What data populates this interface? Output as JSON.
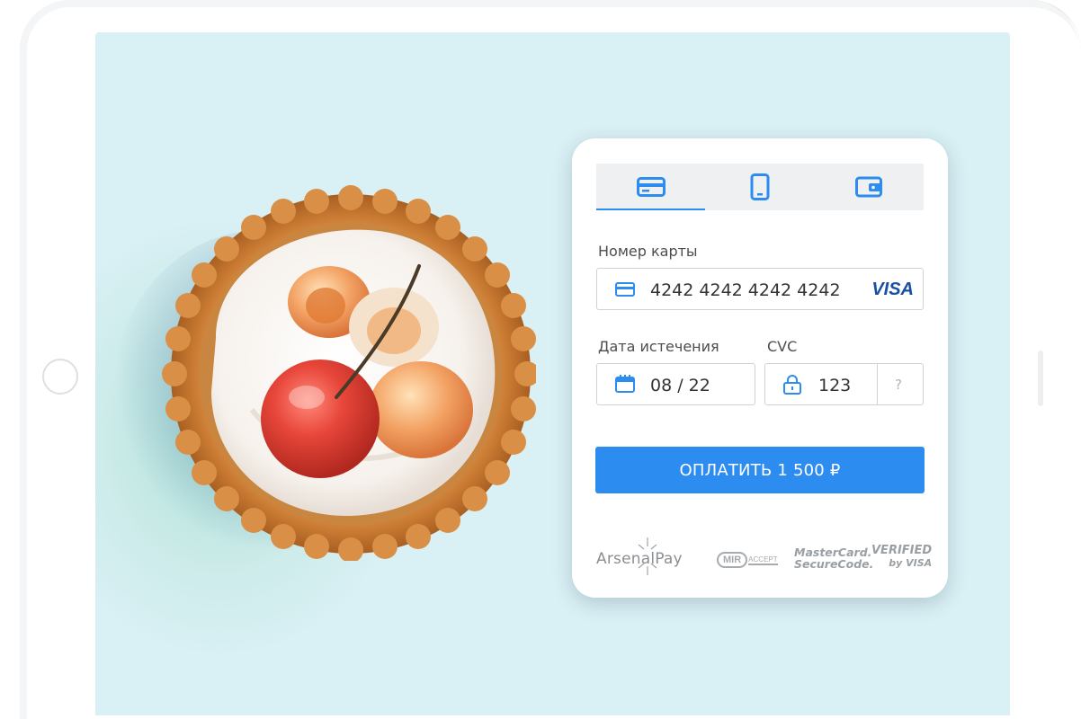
{
  "payment_tabs": [
    {
      "name": "card",
      "icon": "credit-card-icon",
      "active": true
    },
    {
      "name": "phone",
      "icon": "mobile-phone-icon",
      "active": false
    },
    {
      "name": "wallet",
      "icon": "wallet-icon",
      "active": false
    }
  ],
  "card_number": {
    "label": "Номер карты",
    "value": "4242 4242 4242 4242",
    "brand": "VISA"
  },
  "expiry": {
    "label": "Дата истечения",
    "value": "08 / 22"
  },
  "cvc": {
    "label": "CVC",
    "value": "123",
    "help": "?"
  },
  "pay_button": {
    "label": "ОПЛАТИТЬ 1 500 ₽"
  },
  "logos": {
    "arsenalpay": "ArsenalPay",
    "mir_main": "MIR",
    "mir_sub": "ACCEPT",
    "mastercard_line1": "MasterCard.",
    "mastercard_line2": "SecureCode.",
    "vbv_line1": "VERIFIED",
    "vbv_line2": "by VISA"
  },
  "colors": {
    "accent": "#2d8cf0",
    "screen_bg": "#d9f0f4",
    "visa": "#1a4fa3"
  }
}
